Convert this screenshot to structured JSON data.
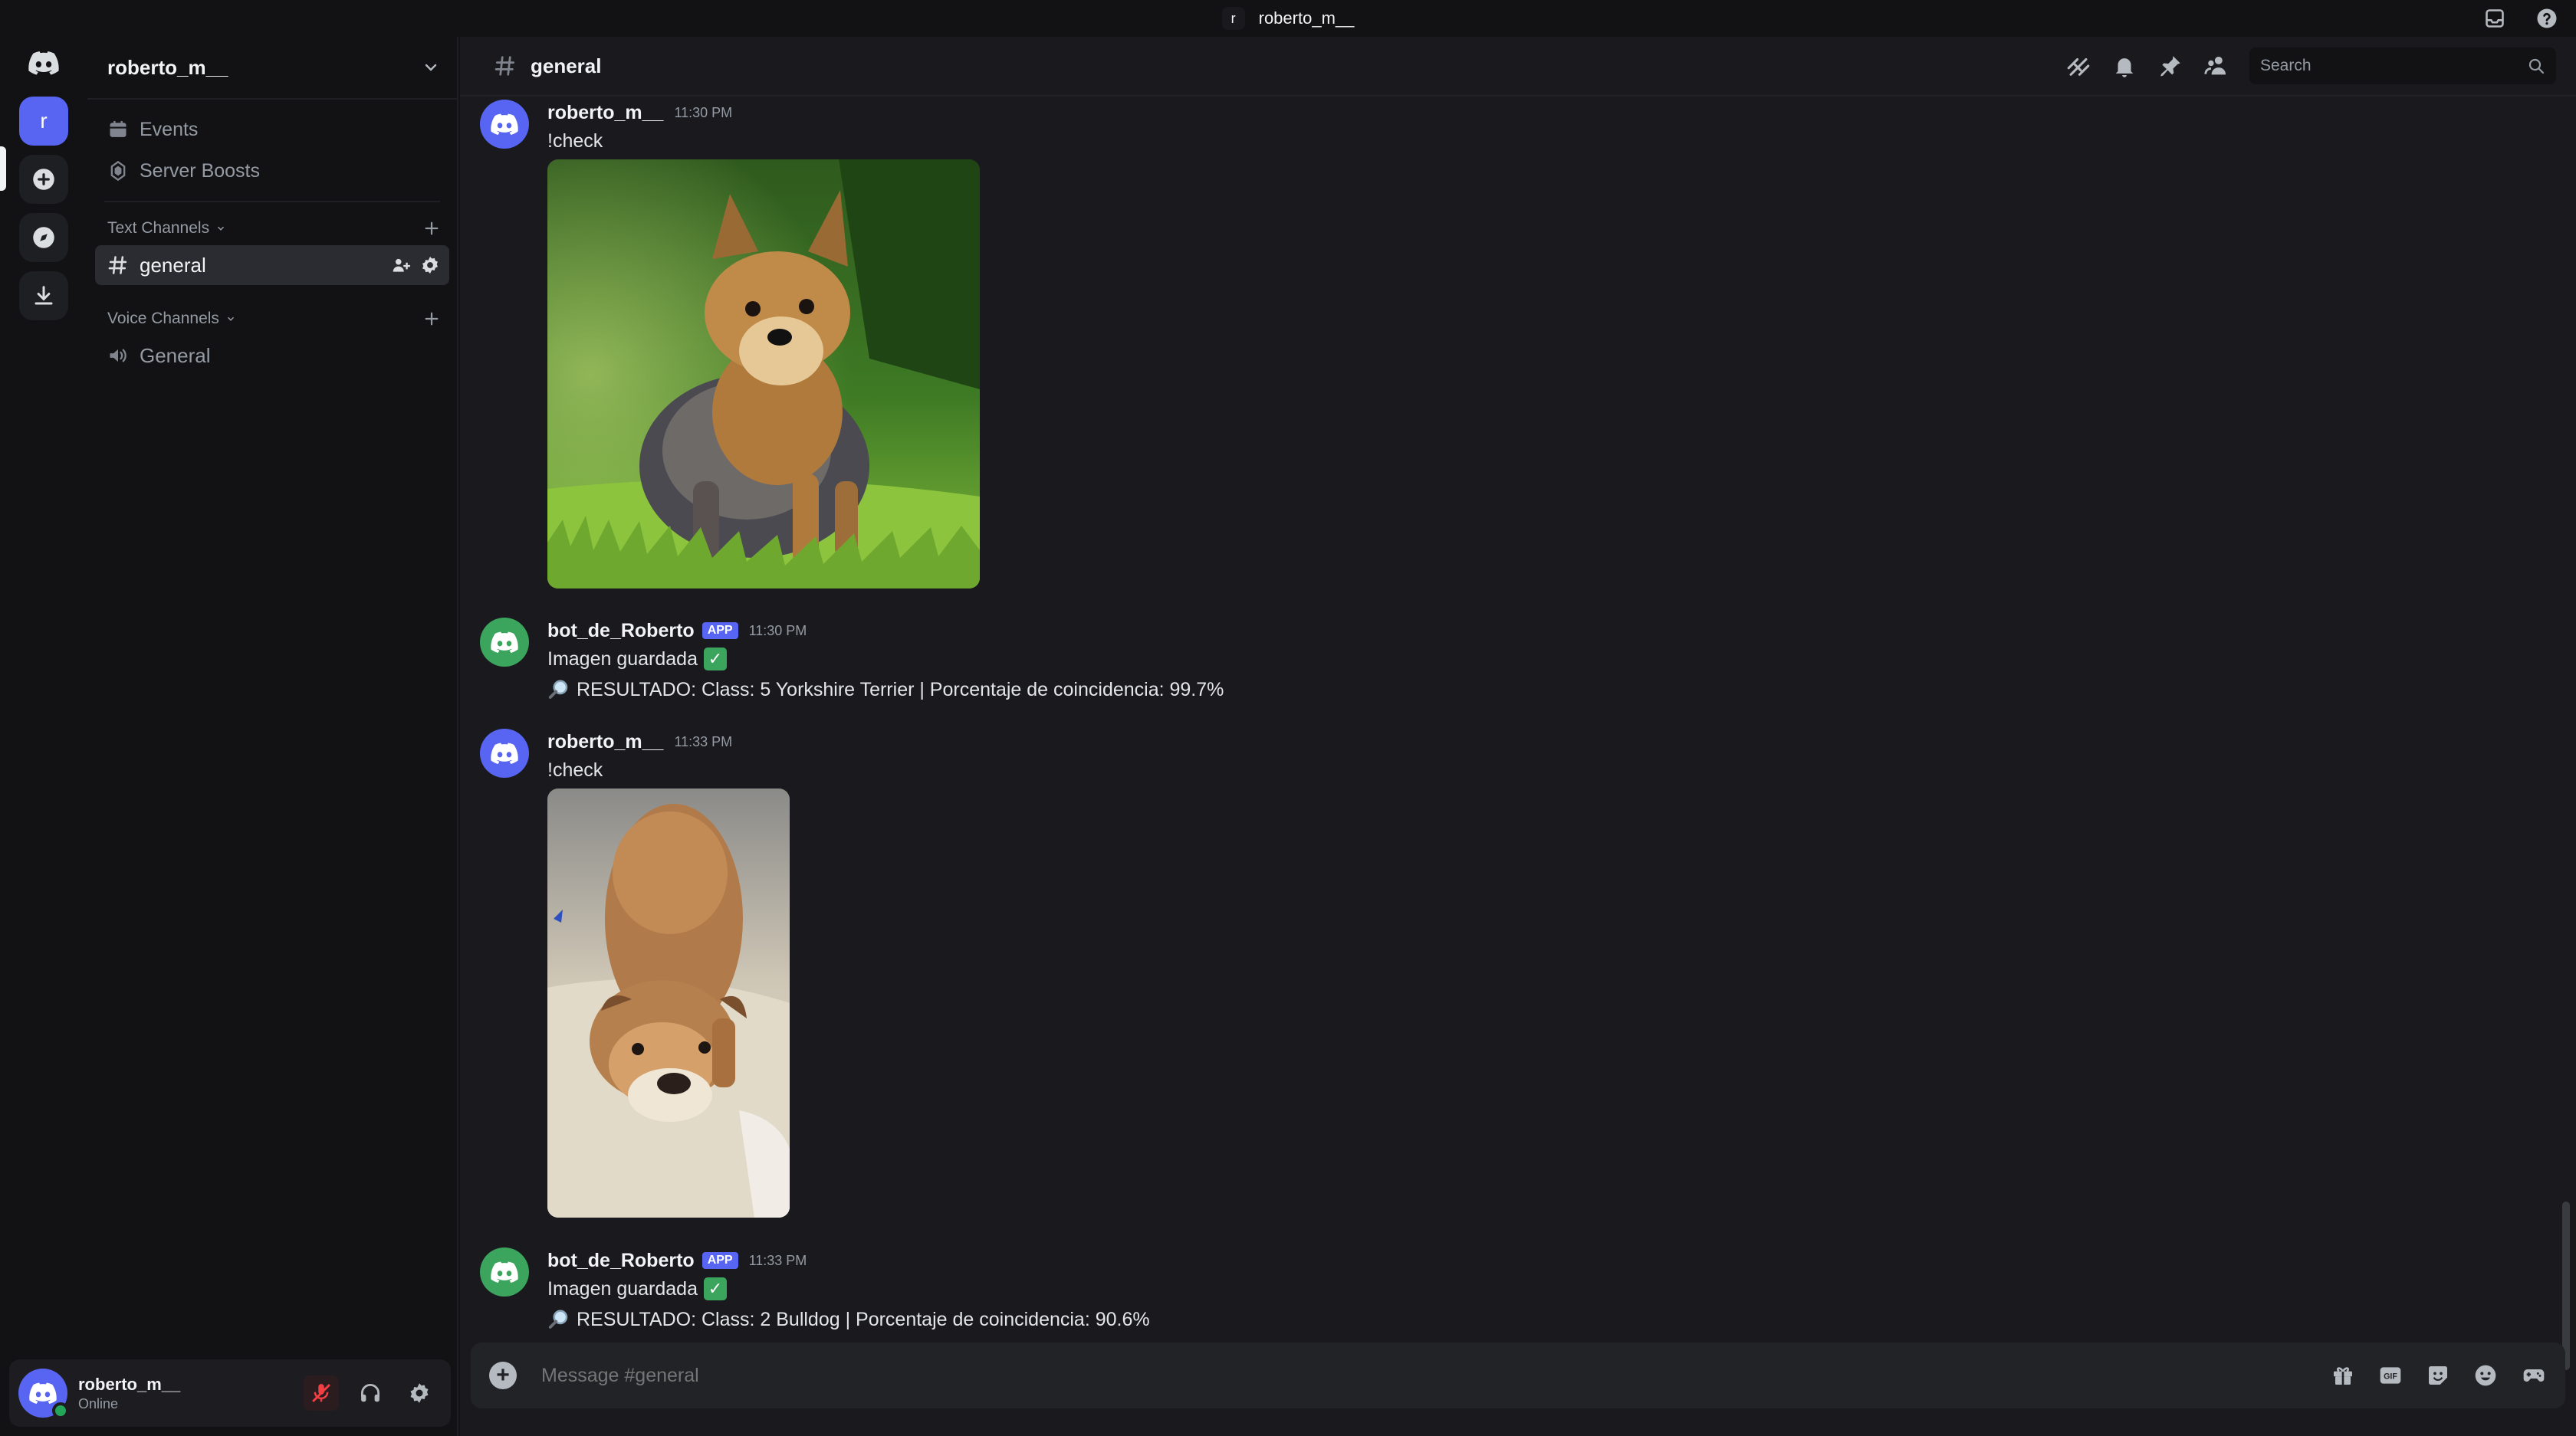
{
  "window": {
    "title": "roberto_m__",
    "badge": "r"
  },
  "rail": {
    "server_initial": "r"
  },
  "sidebar": {
    "server_name": "roberto_m__",
    "items": [
      {
        "label": "Events",
        "icon": "calendar-icon"
      },
      {
        "label": "Server Boosts",
        "icon": "boost-icon"
      }
    ],
    "text_category": "Text Channels",
    "text_channels": [
      {
        "label": "general",
        "active": true
      }
    ],
    "voice_category": "Voice Channels",
    "voice_channels": [
      {
        "label": "General"
      }
    ]
  },
  "user_panel": {
    "name": "roberto_m__",
    "status": "Online"
  },
  "channel_header": {
    "name": "general",
    "search_placeholder": "Search"
  },
  "messages": [
    {
      "author": "roberto_m__",
      "time": "11:30 PM",
      "text": "!check",
      "attachment": "yorkshire-terrier-photo"
    },
    {
      "author": "bot_de_Roberto",
      "badge": "APP",
      "time": "11:30 PM",
      "line1": "Imagen guardada",
      "line2": "RESULTADO: Class: 5 Yorkshire Terrier | Porcentaje de coincidencia: 99.7%"
    },
    {
      "author": "roberto_m__",
      "time": "11:33 PM",
      "text": "!check",
      "attachment": "bulldog-photo"
    },
    {
      "author": "bot_de_Roberto",
      "badge": "APP",
      "time": "11:33 PM",
      "line1": "Imagen guardada",
      "line2": "RESULTADO: Class: 2 Bulldog | Porcentaje de coincidencia: 90.6%"
    }
  ],
  "composer": {
    "placeholder": "Message #general"
  },
  "colors": {
    "blurple": "#5865f2",
    "bot_green": "#3ba55d",
    "online": "#23a55a"
  }
}
